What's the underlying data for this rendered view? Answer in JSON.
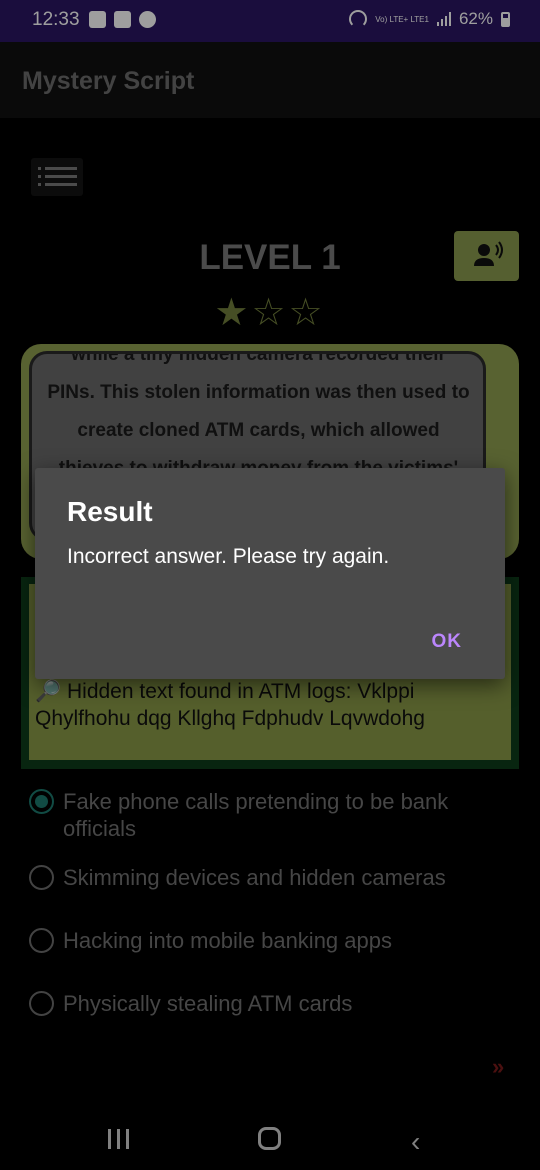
{
  "status_bar": {
    "time": "12:33",
    "network": "Vo) LTE+ LTE1",
    "battery": "62%"
  },
  "app": {
    "title": "Mystery Script"
  },
  "level": {
    "title": "LEVEL 1",
    "stars": "★☆☆",
    "rating_value": 1,
    "rating_max": 3
  },
  "story": {
    "text": "while a tiny hidden camera recorded their PINs. This stolen information was then used to create cloned ATM cards, which allowed thieves to withdraw money from the victims' accounts."
  },
  "clue": {
    "text": "🔎 Hidden text found in ATM logs: Vklppi Qhylfhohu dqg Kllghq Fdphudv Lqvwdohg"
  },
  "options": [
    {
      "label": "Fake phone calls pretending to be bank officials",
      "selected": true
    },
    {
      "label": "Skimming devices and hidden cameras",
      "selected": false
    },
    {
      "label": "Hacking into mobile banking apps",
      "selected": false
    },
    {
      "label": "Physically stealing ATM cards",
      "selected": false
    }
  ],
  "next": {
    "label": "»"
  },
  "dialog": {
    "title": "Result",
    "message": "Incorrect answer. Please try again.",
    "ok_label": "OK"
  },
  "colors": {
    "status_bar": "#2a1563",
    "card_green": "#8f9e4f",
    "radio_selected": "#1c7a6e",
    "dialog_bg": "#4a4a4a",
    "dialog_button": "#bb86fc"
  },
  "icons": {
    "menu": "menu-list-icon",
    "speak": "speaker-person-icon",
    "nav_recent": "recent-apps-icon",
    "nav_home": "home-icon",
    "nav_back": "back-chevron-icon"
  }
}
